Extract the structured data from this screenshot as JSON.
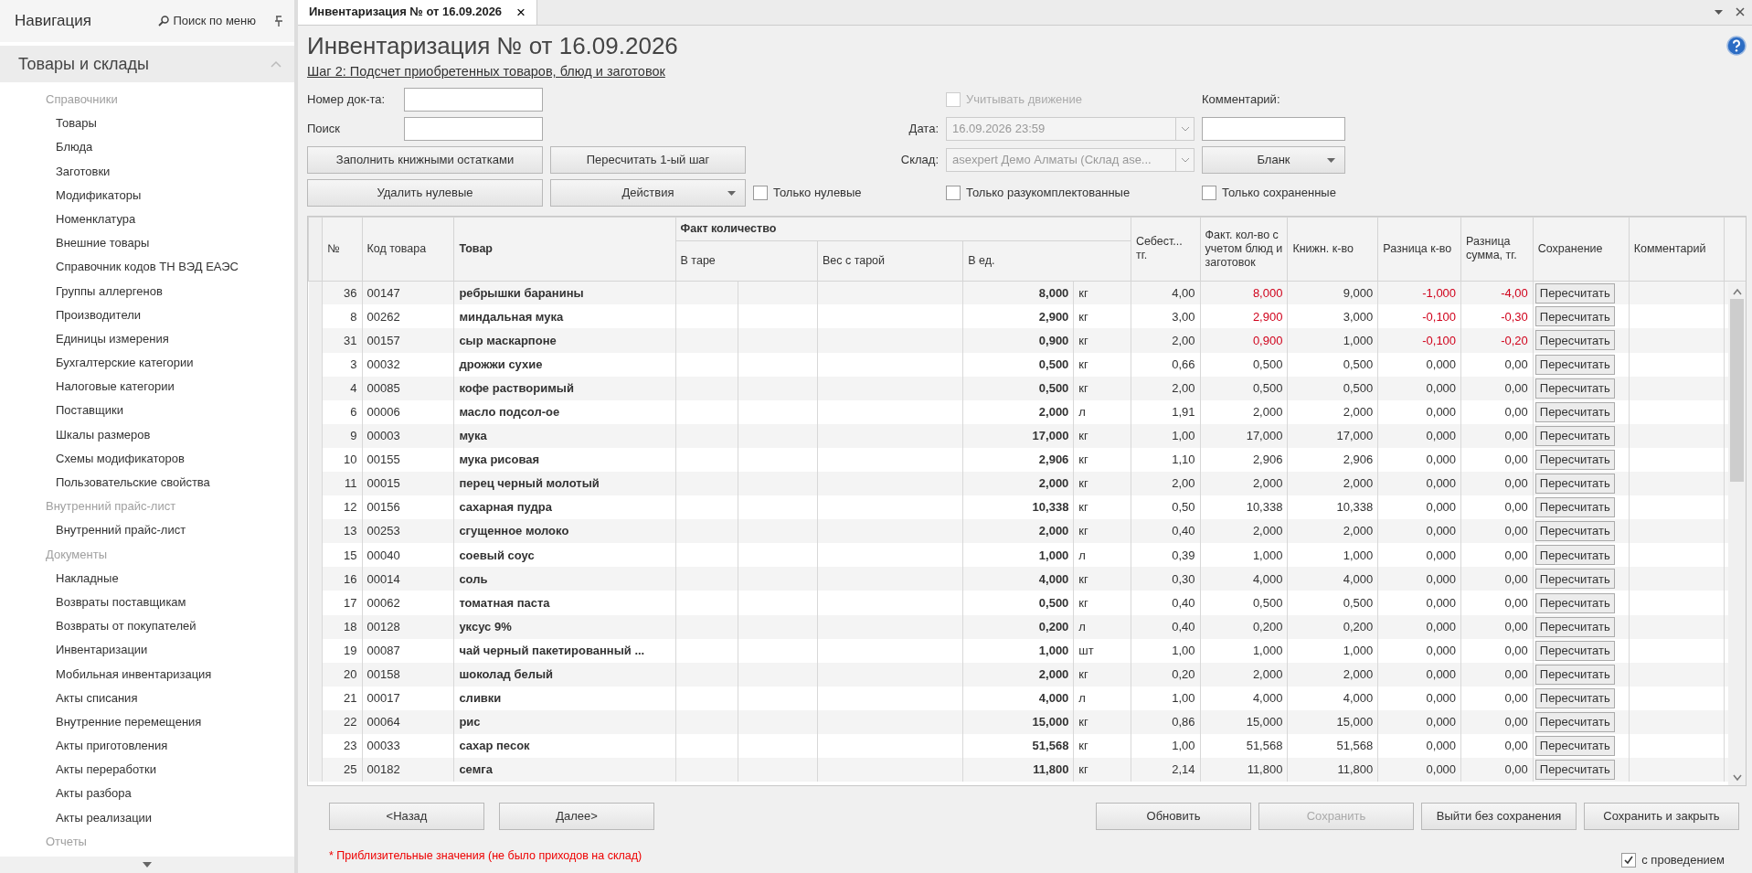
{
  "sidebar": {
    "title": "Навигация",
    "search": "Поиск по меню",
    "section": {
      "title": "Товары и склады",
      "expanded": true
    },
    "groups": [
      {
        "title": "Справочники",
        "items": [
          "Товары",
          "Блюда",
          "Заготовки",
          "Модификаторы",
          "Номенклатура",
          "Внешние товары",
          "Справочник кодов ТН ВЭД ЕАЭС",
          "Группы аллергенов",
          "Производители",
          "Единицы измерения",
          "Бухгалтерские категории",
          "Налоговые категории",
          "Поставщики",
          "Шкалы размеров",
          "Схемы модификаторов",
          "Пользовательские свойства"
        ]
      },
      {
        "title": "Внутренний прайс-лист",
        "items": [
          "Внутренний прайс-лист"
        ]
      },
      {
        "title": "Документы",
        "items": [
          "Накладные",
          "Возвраты поставщикам",
          "Возвраты от покупателей",
          "Инвентаризации",
          "Мобильная инвентаризация",
          "Акты списания",
          "Внутренние перемещения",
          "Акты приготовления",
          "Акты переработки",
          "Акты разбора",
          "Акты реализации"
        ]
      },
      {
        "title": "Отчеты"
      }
    ]
  },
  "tab": {
    "title": "Инвентаризация № от 16.09.2026",
    "close": "×",
    "selected": true
  },
  "document": {
    "title": "Инвентаризация № от 16.09.2026",
    "step": "Шаг 2: Подсчет приобретенных товаров, блюд и заготовок",
    "doc_number": {
      "label": "Номер док-та:"
    },
    "search": {
      "label": "Поиск"
    },
    "track_movement": {
      "label": "Учитывать движение",
      "checked": false,
      "disabled": true
    },
    "comment": {
      "label": "Комментарий:"
    },
    "date": {
      "label": "Дата:",
      "value": "16.09.2026 23:59",
      "disabled": true
    },
    "warehouse": {
      "label": "Склад:",
      "value": "asexpert Демо Алматы (Склад ase...",
      "disabled": true
    },
    "buttons": [
      {
        "label": "Заполнить книжными остатками",
        "has_menu": false
      },
      {
        "label": "Пересчитать 1-ый шаг",
        "has_menu": false
      },
      {
        "label": "Бланк",
        "has_menu": true
      },
      {
        "label": "Удалить нулевые",
        "has_menu": false
      },
      {
        "label": "Действия",
        "has_menu": true
      }
    ],
    "filters": [
      {
        "label": "Только нулевые",
        "checked": false
      },
      {
        "label": "Только разукомплектованные",
        "checked": false
      },
      {
        "label": "Только сохраненные",
        "checked": false
      }
    ]
  },
  "table": {
    "columns": {
      "num": "№",
      "code": "Код товара",
      "name": "Товар",
      "fact_group": "Факт количество",
      "in_tare": "В таре",
      "weight_tare": "Вес с тарой",
      "in_units": "В ед.",
      "cost": "Себест... тг.",
      "fact_total": "Факт. кол-во с учетом блюд и заготовок",
      "book": "Книжн. к-во",
      "diff_qty": "Разница к-во",
      "diff_sum": "Разница сумма, тг.",
      "saving": "Сохранение",
      "comment": "Комментарий"
    },
    "rows": [
      {
        "num": "36",
        "code": "00147",
        "name": "ребрышки баранины",
        "qty": "8,000",
        "unit": "кг",
        "cost": "4,00",
        "fact": "8,000",
        "book": "9,000",
        "diff_qty": "-1,000",
        "diff_sum": "-4,00",
        "action": "Пересчитать",
        "shortage": true
      },
      {
        "num": "8",
        "code": "00262",
        "name": "миндальная мука",
        "qty": "2,900",
        "unit": "кг",
        "cost": "3,00",
        "fact": "2,900",
        "book": "3,000",
        "diff_qty": "-0,100",
        "diff_sum": "-0,30",
        "action": "Пересчитать",
        "shortage": true
      },
      {
        "num": "31",
        "code": "00157",
        "name": "сыр маскарпоне",
        "qty": "0,900",
        "unit": "кг",
        "cost": "2,00",
        "fact": "0,900",
        "book": "1,000",
        "diff_qty": "-0,100",
        "diff_sum": "-0,20",
        "action": "Пересчитать",
        "shortage": true
      },
      {
        "num": "3",
        "code": "00032",
        "name": "дрожжи сухие",
        "qty": "0,500",
        "unit": "кг",
        "cost": "0,66",
        "fact": "0,500",
        "book": "0,500",
        "diff_qty": "0,000",
        "diff_sum": "0,00",
        "action": "Пересчитать",
        "shortage": false
      },
      {
        "num": "4",
        "code": "00085",
        "name": "кофе растворимый",
        "qty": "0,500",
        "unit": "кг",
        "cost": "2,00",
        "fact": "0,500",
        "book": "0,500",
        "diff_qty": "0,000",
        "diff_sum": "0,00",
        "action": "Пересчитать",
        "shortage": false
      },
      {
        "num": "6",
        "code": "00006",
        "name": "масло подсол-ое",
        "qty": "2,000",
        "unit": "л",
        "cost": "1,91",
        "fact": "2,000",
        "book": "2,000",
        "diff_qty": "0,000",
        "diff_sum": "0,00",
        "action": "Пересчитать",
        "shortage": false
      },
      {
        "num": "9",
        "code": "00003",
        "name": "мука",
        "qty": "17,000",
        "unit": "кг",
        "cost": "1,00",
        "fact": "17,000",
        "book": "17,000",
        "diff_qty": "0,000",
        "diff_sum": "0,00",
        "action": "Пересчитать",
        "shortage": false
      },
      {
        "num": "10",
        "code": "00155",
        "name": "мука рисовая",
        "qty": "2,906",
        "unit": "кг",
        "cost": "1,10",
        "fact": "2,906",
        "book": "2,906",
        "diff_qty": "0,000",
        "diff_sum": "0,00",
        "action": "Пересчитать",
        "shortage": false
      },
      {
        "num": "11",
        "code": "00015",
        "name": "перец черный молотый",
        "qty": "2,000",
        "unit": "кг",
        "cost": "2,00",
        "fact": "2,000",
        "book": "2,000",
        "diff_qty": "0,000",
        "diff_sum": "0,00",
        "action": "Пересчитать",
        "shortage": false
      },
      {
        "num": "12",
        "code": "00156",
        "name": "сахарная пудра",
        "qty": "10,338",
        "unit": "кг",
        "cost": "0,50",
        "fact": "10,338",
        "book": "10,338",
        "diff_qty": "0,000",
        "diff_sum": "0,00",
        "action": "Пересчитать",
        "shortage": false
      },
      {
        "num": "13",
        "code": "00253",
        "name": "сгущенное молоко",
        "qty": "2,000",
        "unit": "кг",
        "cost": "0,40",
        "fact": "2,000",
        "book": "2,000",
        "diff_qty": "0,000",
        "diff_sum": "0,00",
        "action": "Пересчитать",
        "shortage": false
      },
      {
        "num": "15",
        "code": "00040",
        "name": "соевый соус",
        "qty": "1,000",
        "unit": "л",
        "cost": "0,39",
        "fact": "1,000",
        "book": "1,000",
        "diff_qty": "0,000",
        "diff_sum": "0,00",
        "action": "Пересчитать",
        "shortage": false
      },
      {
        "num": "16",
        "code": "00014",
        "name": "соль",
        "qty": "4,000",
        "unit": "кг",
        "cost": "0,30",
        "fact": "4,000",
        "book": "4,000",
        "diff_qty": "0,000",
        "diff_sum": "0,00",
        "action": "Пересчитать",
        "shortage": false
      },
      {
        "num": "17",
        "code": "00062",
        "name": "томатная паста",
        "qty": "0,500",
        "unit": "кг",
        "cost": "0,40",
        "fact": "0,500",
        "book": "0,500",
        "diff_qty": "0,000",
        "diff_sum": "0,00",
        "action": "Пересчитать",
        "shortage": false
      },
      {
        "num": "18",
        "code": "00128",
        "name": "уксус 9%",
        "qty": "0,200",
        "unit": "л",
        "cost": "0,40",
        "fact": "0,200",
        "book": "0,200",
        "diff_qty": "0,000",
        "diff_sum": "0,00",
        "action": "Пересчитать",
        "shortage": false
      },
      {
        "num": "19",
        "code": "00087",
        "name": "чай черный пакетированный ...",
        "qty": "1,000",
        "unit": "шт",
        "cost": "1,00",
        "fact": "1,000",
        "book": "1,000",
        "diff_qty": "0,000",
        "diff_sum": "0,00",
        "action": "Пересчитать",
        "shortage": false
      },
      {
        "num": "20",
        "code": "00158",
        "name": "шоколад белый",
        "qty": "2,000",
        "unit": "кг",
        "cost": "0,20",
        "fact": "2,000",
        "book": "2,000",
        "diff_qty": "0,000",
        "diff_sum": "0,00",
        "action": "Пересчитать",
        "shortage": false
      },
      {
        "num": "21",
        "code": "00017",
        "name": "сливки",
        "qty": "4,000",
        "unit": "л",
        "cost": "1,00",
        "fact": "4,000",
        "book": "4,000",
        "diff_qty": "0,000",
        "diff_sum": "0,00",
        "action": "Пересчитать",
        "shortage": false
      },
      {
        "num": "22",
        "code": "00064",
        "name": "рис",
        "qty": "15,000",
        "unit": "кг",
        "cost": "0,86",
        "fact": "15,000",
        "book": "15,000",
        "diff_qty": "0,000",
        "diff_sum": "0,00",
        "action": "Пересчитать",
        "shortage": false
      },
      {
        "num": "23",
        "code": "00033",
        "name": "сахар песок",
        "qty": "51,568",
        "unit": "кг",
        "cost": "1,00",
        "fact": "51,568",
        "book": "51,568",
        "diff_qty": "0,000",
        "diff_sum": "0,00",
        "action": "Пересчитать",
        "shortage": false
      },
      {
        "num": "25",
        "code": "00182",
        "name": "семга",
        "qty": "11,800",
        "unit": "кг",
        "cost": "2,14",
        "fact": "11,800",
        "book": "11,800",
        "diff_qty": "0,000",
        "diff_sum": "0,00",
        "action": "Пересчитать",
        "shortage": false
      }
    ]
  },
  "footer": {
    "nav_buttons": [
      {
        "label": "<Назад",
        "disabled": false
      },
      {
        "label": "Далее>",
        "disabled": false
      }
    ],
    "action_buttons": [
      {
        "label": "Обновить",
        "disabled": false
      },
      {
        "label": "Сохранить",
        "disabled": true
      },
      {
        "label": "Выйти без сохранения",
        "disabled": false
      },
      {
        "label": "Сохранить и закрыть",
        "disabled": false
      }
    ],
    "note": "* Приблизительные значения (не было приходов на склад)",
    "post": {
      "label": "с проведением",
      "checked": true
    }
  }
}
